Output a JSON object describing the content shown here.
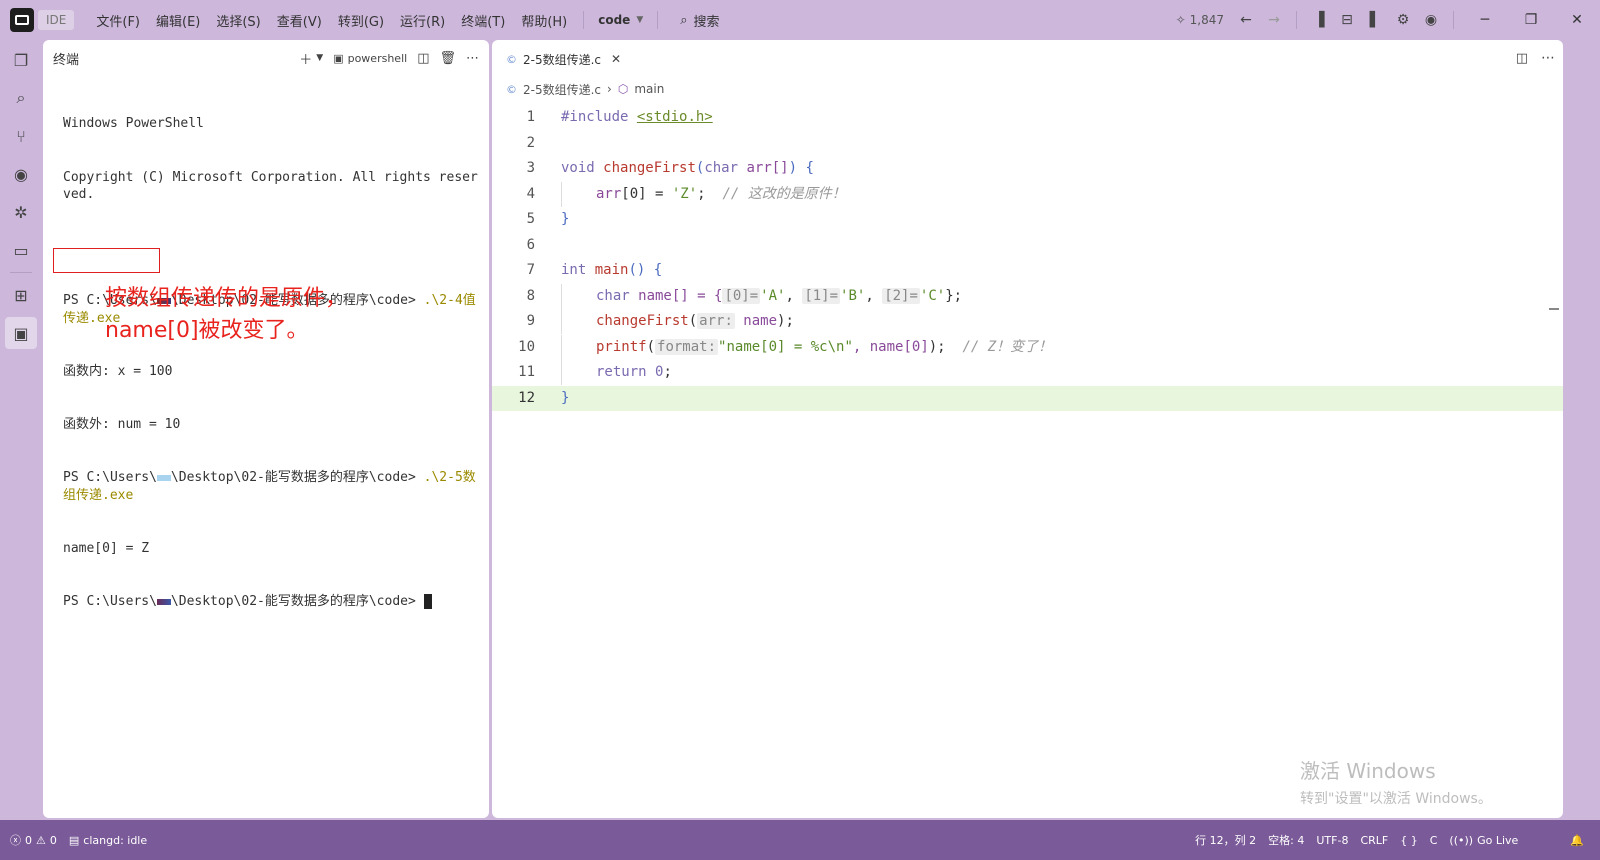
{
  "titlebar": {
    "badge": "IDE",
    "menu": [
      "文件(F)",
      "编辑(E)",
      "选择(S)",
      "查看(V)",
      "转到(G)",
      "运行(R)",
      "终端(T)",
      "帮助(H)"
    ],
    "workspace": "code",
    "search_label": "搜索",
    "count": "1,847"
  },
  "terminal": {
    "title": "终端",
    "shell": "powershell",
    "lines": [
      "Windows PowerShell",
      "Copyright (C) Microsoft Corporation. All rights reserved.",
      "",
      "PS C:\\Users\\",
      "\\Desktop\\02-能写数据多的程序\\code> ",
      ".\\2-4值传递.exe",
      "函数内: x = 100",
      "函数外: num = 10",
      "PS C:\\Users\\",
      "\\Desktop\\02-能写数据多的程序\\code> ",
      ".\\2-5数组传递.exe",
      "name[0] = Z",
      "PS C:\\Users\\",
      "\\Desktop\\02-能写数据多的程序\\code> "
    ],
    "annotation_line1": "按数组传递传的是原件，",
    "annotation_line2": "name[0]被改变了。"
  },
  "editor": {
    "tab_label": "2-5数组传递.c",
    "breadcrumb_file": "2-5数组传递.c",
    "breadcrumb_symbol": "main",
    "line_numbers": [
      "1",
      "2",
      "3",
      "4",
      "5",
      "6",
      "7",
      "8",
      "9",
      "10",
      "11",
      "12"
    ],
    "code": {
      "l1_kw": "#include",
      "l1_inc": "<stdio.h>",
      "l3_kw": "void",
      "l3_fn": "changeFirst",
      "l3_rest_a": "(",
      "l3_type": "char",
      "l3_param": " arr[]",
      "l3_rest_b": ") {",
      "l4_var": "arr",
      "l4_idx": "[0] = ",
      "l4_str": "'Z'",
      "l4_semi": ";",
      "l4_cmt": "// 这改的是原件！",
      "l5": "}",
      "l7_kw": "int",
      "l7_fn": "main",
      "l7_rest": "() {",
      "l8_kw": "char",
      "l8_var": " name[] = {",
      "l8_h0": "[0]=",
      "l8_s0": "'A'",
      "l8_h1": "[1]=",
      "l8_s1": "'B'",
      "l8_h2": "[2]=",
      "l8_s2": "'C'",
      "l8_end": "};",
      "l9_fn": "changeFirst",
      "l9_hint": "arr:",
      "l9_var": " name",
      "l9_end": ");",
      "l10_fn": "printf",
      "l10_hint": "format:",
      "l10_str": "\"name[0] = %c\\n\"",
      "l10_var": ", name[0]",
      "l10_end": ");",
      "l10_cmt": "// Z！变了！",
      "l11_kw": "return",
      "l11_num": " 0",
      "l11_end": ";",
      "l12": "}"
    },
    "watermark_line1": "激活 Windows",
    "watermark_line2": "转到\"设置\"以激活 Windows。"
  },
  "statusbar": {
    "errors": "0",
    "warnings": "0",
    "lsp": "clangd: idle",
    "position": "行 12，列 2",
    "spaces": "空格: 4",
    "encoding": "UTF-8",
    "eol": "CRLF",
    "braces": "{ }",
    "language": "C",
    "golive": "Go Live"
  },
  "colors": {
    "chrome": "#cdb8dc",
    "status_bar": "#7a5a98",
    "annotation": "#e8231e"
  }
}
